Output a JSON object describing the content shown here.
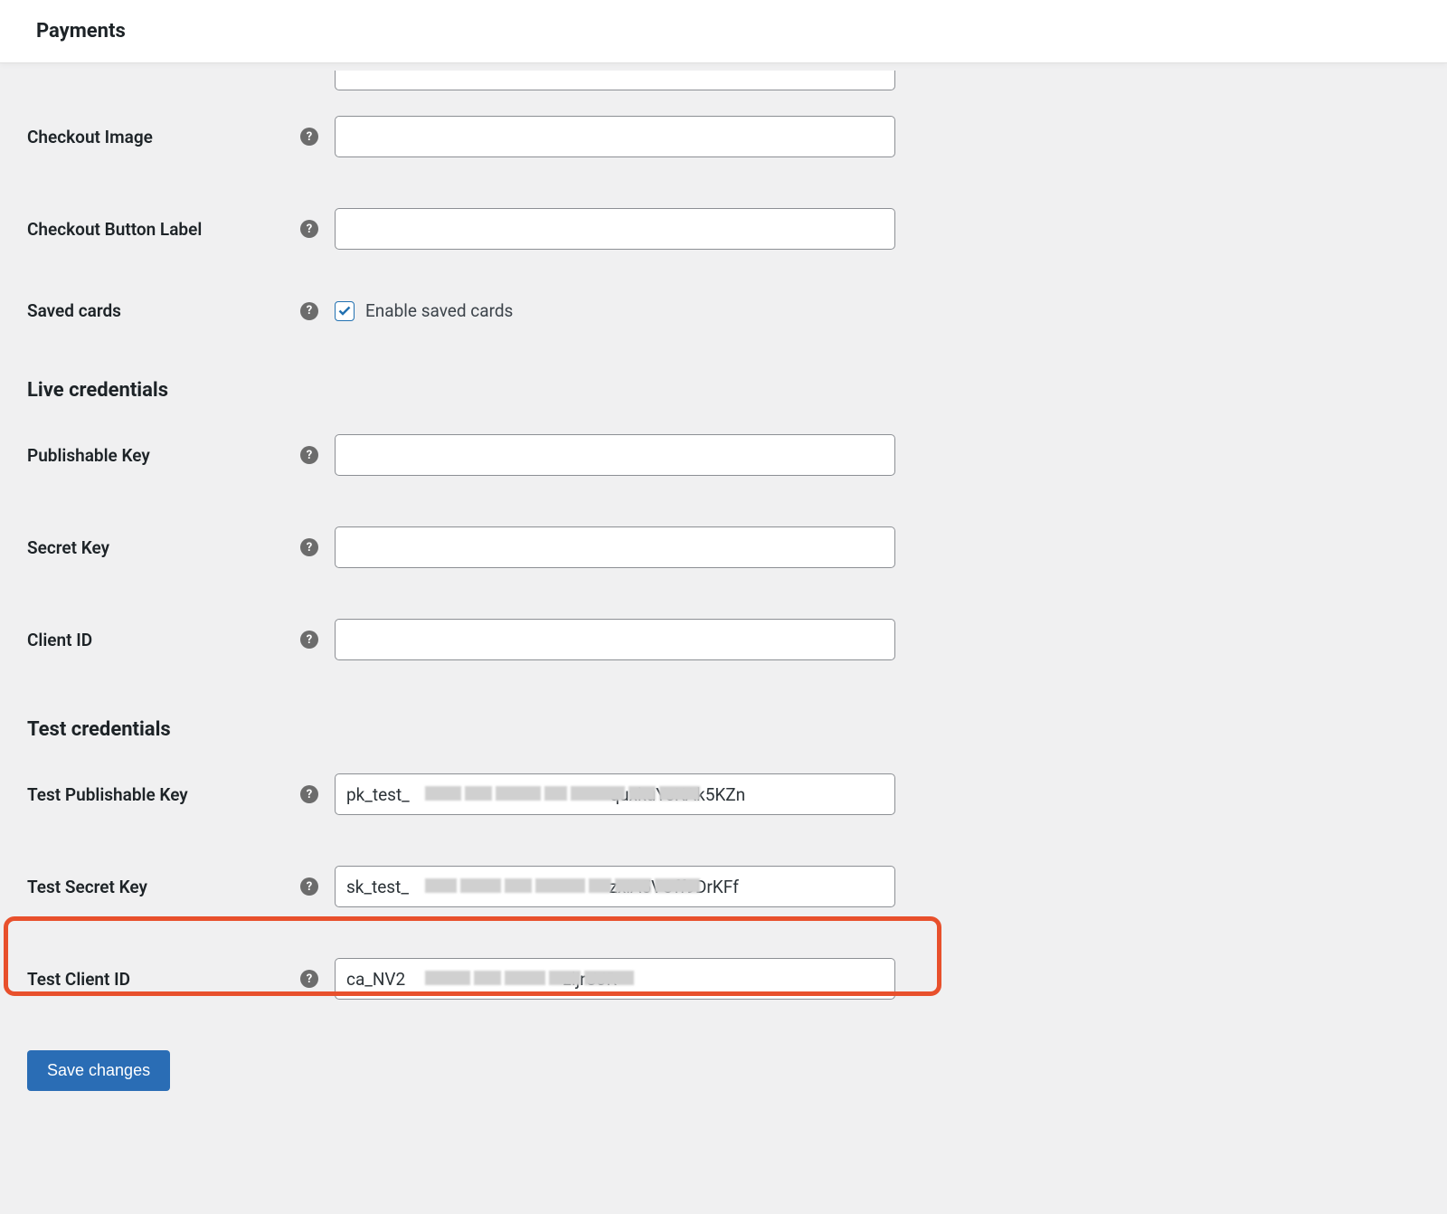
{
  "header": {
    "title": "Payments"
  },
  "fields": {
    "checkout_image": {
      "label": "Checkout Image",
      "value": ""
    },
    "checkout_button_label": {
      "label": "Checkout Button Label",
      "value": ""
    },
    "saved_cards": {
      "label": "Saved cards",
      "checkbox_label": "Enable saved cards",
      "checked": true
    },
    "publishable_key": {
      "label": "Publishable Key",
      "value": ""
    },
    "secret_key": {
      "label": "Secret Key",
      "value": ""
    },
    "client_id": {
      "label": "Client ID",
      "value": ""
    },
    "test_publishable_key": {
      "label": "Test Publishable Key",
      "value": "pk_test_                                               quxkuYsKAk5KZn"
    },
    "test_secret_key": {
      "label": "Test Secret Key",
      "value": "sk_test_                                               zxiA5VOff9DrKFf"
    },
    "test_client_id": {
      "label": "Test Client ID",
      "value": "ca_NV2                                     zljrUJR"
    }
  },
  "sections": {
    "live_credentials": "Live credentials",
    "test_credentials": "Test credentials"
  },
  "buttons": {
    "save": "Save changes"
  }
}
